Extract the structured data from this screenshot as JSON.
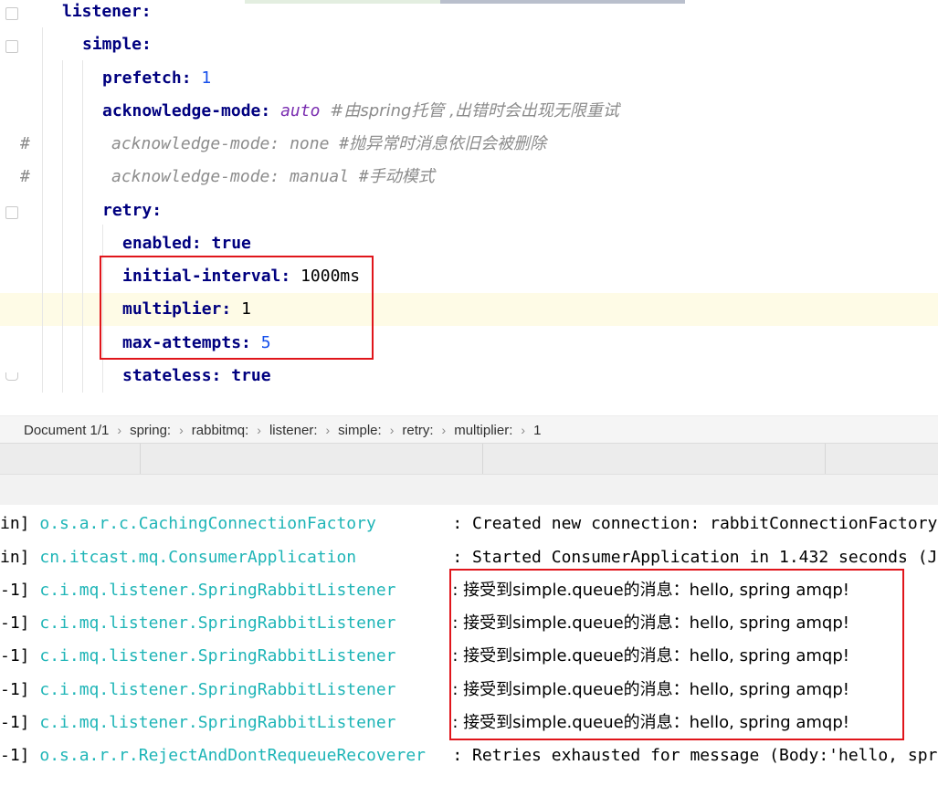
{
  "editor": {
    "lines": [
      {
        "key": "listener",
        "sep": ":"
      },
      {
        "key": "simple",
        "sep": ":"
      },
      {
        "key": "prefetch",
        "sep": ": ",
        "value": "1"
      },
      {
        "key": "acknowledge-mode",
        "sep": ": ",
        "value": "auto",
        "comment": "#由spring托管 ,出错时会出现无限重试"
      },
      {
        "commented_text": "acknowledge-mode: none #抛异常时消息依旧会被删除"
      },
      {
        "commented_text": "acknowledge-mode: manual #手动模式"
      },
      {
        "key": "retry",
        "sep": ":"
      },
      {
        "key": "enabled",
        "sep": ": ",
        "value": "true"
      },
      {
        "key": "initial-interval",
        "sep": ": ",
        "value": "1000ms"
      },
      {
        "key": "multiplier",
        "sep": ": ",
        "value": "1"
      },
      {
        "key": "max-attempts",
        "sep": ": ",
        "value": "5"
      },
      {
        "key": "stateless",
        "sep": ": ",
        "value": "true"
      }
    ],
    "gutter_hash": "#"
  },
  "breadcrumb": {
    "items": [
      "Document 1/1",
      "spring:",
      "rabbitmq:",
      "listener:",
      "simple:",
      "retry:",
      "multiplier:",
      "1"
    ],
    "separator": "›"
  },
  "console": {
    "lines": [
      {
        "thread": "in]",
        "logger": "o.s.a.r.c.CachingConnectionFactory",
        "message": ": Created new connection: rabbitConnectionFactory"
      },
      {
        "thread": "in]",
        "logger": "cn.itcast.mq.ConsumerApplication",
        "message": ": Started ConsumerApplication in 1.432 seconds (J"
      },
      {
        "thread": "-1]",
        "logger": "c.i.mq.listener.SpringRabbitListener",
        "message": ": 接受到simple.queue的消息：hello, spring amqp!"
      },
      {
        "thread": "-1]",
        "logger": "c.i.mq.listener.SpringRabbitListener",
        "message": ": 接受到simple.queue的消息：hello, spring amqp!"
      },
      {
        "thread": "-1]",
        "logger": "c.i.mq.listener.SpringRabbitListener",
        "message": ": 接受到simple.queue的消息：hello, spring amqp!"
      },
      {
        "thread": "-1]",
        "logger": "c.i.mq.listener.SpringRabbitListener",
        "message": ": 接受到simple.queue的消息：hello, spring amqp!"
      },
      {
        "thread": "-1]",
        "logger": "c.i.mq.listener.SpringRabbitListener",
        "message": ": 接受到simple.queue的消息：hello, spring amqp!"
      },
      {
        "thread": "-1]",
        "logger": "o.s.a.r.r.RejectAndDontRequeueRecoverer",
        "message": ": Retries exhausted for message (Body:'hello, spr"
      }
    ]
  },
  "colors": {
    "key": "#00007f",
    "number": "#1750eb",
    "logger": "#1fb5b7",
    "comment": "#8c8c8c",
    "highlight_box": "#e0151b"
  }
}
